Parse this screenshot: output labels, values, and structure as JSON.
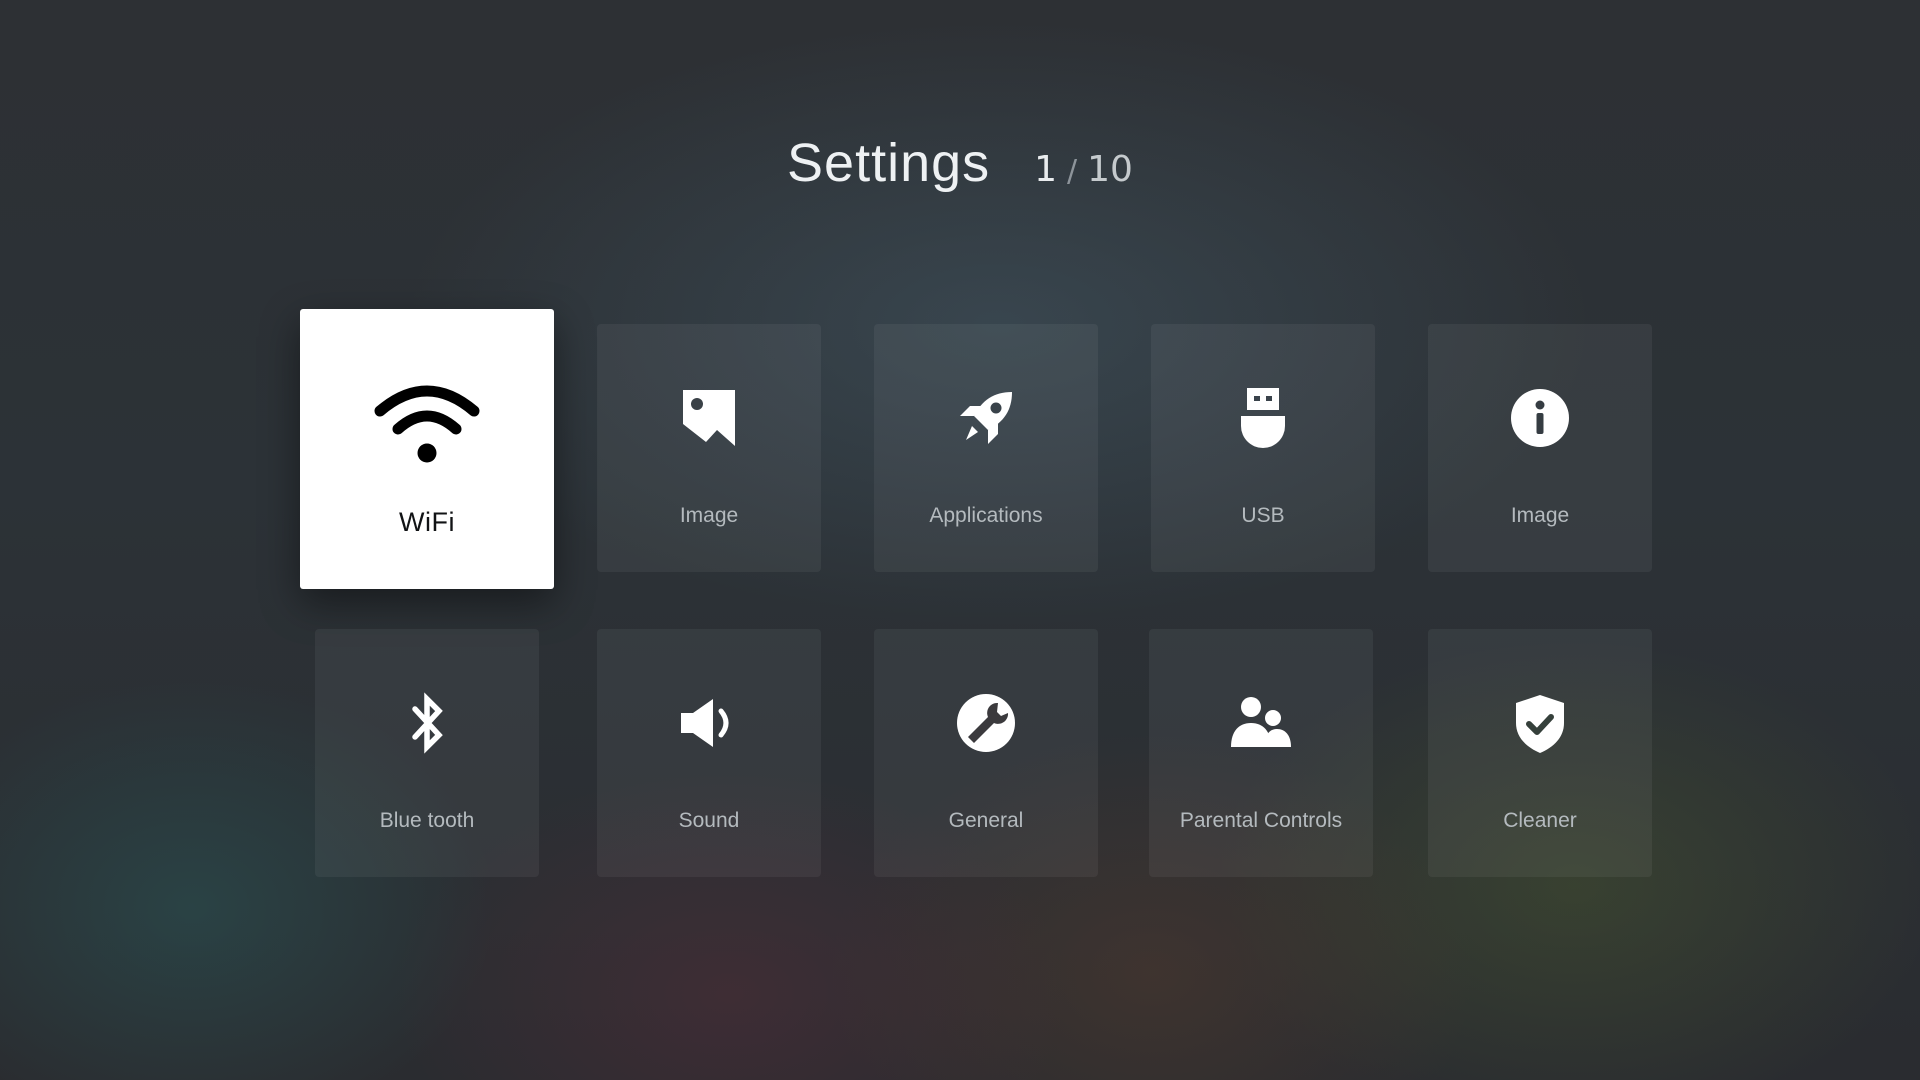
{
  "header": {
    "title": "Settings",
    "page_current": "1",
    "page_separator": "/",
    "page_total": "10"
  },
  "tiles": [
    {
      "label": "WiFi",
      "icon": "wifi-icon",
      "focused": true
    },
    {
      "label": "Image",
      "icon": "image-icon",
      "focused": false
    },
    {
      "label": "Applications",
      "icon": "rocket-icon",
      "focused": false
    },
    {
      "label": "USB",
      "icon": "usb-icon",
      "focused": false
    },
    {
      "label": "Image",
      "icon": "info-icon",
      "focused": false
    },
    {
      "label": "Blue tooth",
      "icon": "bluetooth-icon",
      "focused": false
    },
    {
      "label": "Sound",
      "icon": "speaker-icon",
      "focused": false
    },
    {
      "label": "General",
      "icon": "wrench-icon",
      "focused": false
    },
    {
      "label": "Parental Controls",
      "icon": "users-icon",
      "focused": false
    },
    {
      "label": "Cleaner",
      "icon": "shield-check-icon",
      "focused": false
    }
  ],
  "colors": {
    "tile_focused_bg": "#ffffff",
    "tile_bg": "rgba(255,255,255,0.055)",
    "text_primary": "#eef1f3",
    "text_tile": "#b4babe"
  }
}
